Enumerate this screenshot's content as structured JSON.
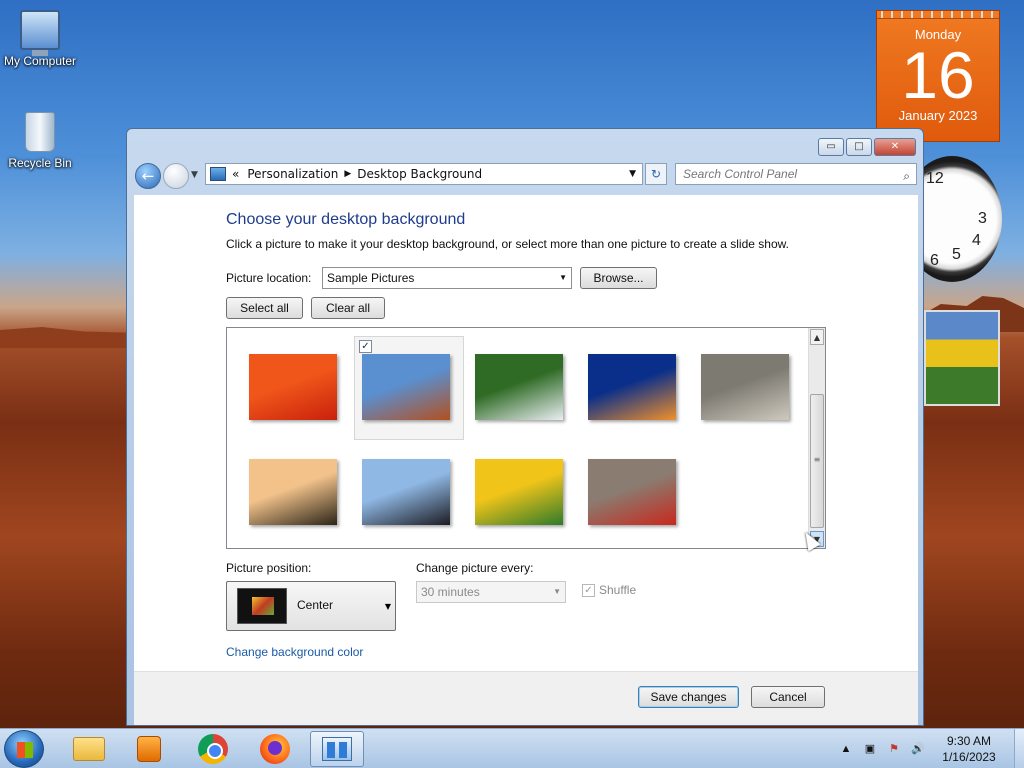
{
  "desktop": {
    "icons": [
      {
        "label": "My Computer"
      },
      {
        "label": "Recycle Bin"
      }
    ],
    "calendar": {
      "weekday": "Monday",
      "day": "16",
      "month_year": "January 2023"
    },
    "clock": {
      "numerals": [
        "12",
        "3",
        "4",
        "5",
        "6"
      ]
    }
  },
  "window": {
    "caption_buttons": {
      "minimize": "▭",
      "maximize": "□",
      "close": "✕"
    },
    "nav": {
      "back_glyph": "←",
      "address": {
        "prefix": "«",
        "crumbs": [
          "Personalization",
          "Desktop Background"
        ],
        "separator": "▶",
        "dropdown": "▼"
      },
      "refresh_glyph": "↻",
      "search": {
        "placeholder": "Search Control Panel"
      }
    },
    "content": {
      "title": "Choose your desktop background",
      "description": "Click a picture to make it your desktop background, or select more than one picture to create a slide show.",
      "picture_location_label": "Picture location:",
      "picture_location_value": "Sample Pictures",
      "browse_button": "Browse...",
      "select_all_button": "Select all",
      "clear_all_button": "Clear all",
      "thumbnails": [
        {
          "name": "chrysanthemum",
          "selected": false,
          "colors": [
            "#f0561a",
            "#c9210c"
          ]
        },
        {
          "name": "desert",
          "selected": true,
          "colors": [
            "#5a8fd0",
            "#b3501f"
          ]
        },
        {
          "name": "hydrangeas",
          "selected": false,
          "colors": [
            "#2f6b24",
            "#e9eef3"
          ]
        },
        {
          "name": "jellyfish",
          "selected": false,
          "colors": [
            "#0a2f8a",
            "#f0902a"
          ]
        },
        {
          "name": "koala",
          "selected": false,
          "colors": [
            "#7d7a72",
            "#cfc9bd"
          ]
        },
        {
          "name": "lighthouse",
          "selected": false,
          "colors": [
            "#f2c28a",
            "#2b2418"
          ]
        },
        {
          "name": "penguins",
          "selected": false,
          "colors": [
            "#8fb8e4",
            "#1c1c22"
          ]
        },
        {
          "name": "tulips",
          "selected": false,
          "colors": [
            "#f0c419",
            "#2f7a2a"
          ]
        },
        {
          "name": "santa",
          "selected": false,
          "colors": [
            "#8a7c70",
            "#c8281e"
          ]
        }
      ],
      "checkmark": "✓",
      "position_label": "Picture position:",
      "position_value": "Center",
      "interval_label": "Change picture every:",
      "interval_value": "30 minutes",
      "shuffle_label": "Shuffle",
      "shuffle_checked": true,
      "background_color_link": "Change background color"
    },
    "footer": {
      "save_button": "Save changes",
      "cancel_button": "Cancel"
    }
  },
  "taskbar": {
    "apps": [
      "explorer",
      "media-player",
      "chrome",
      "firefox",
      "control-panel"
    ],
    "active_app": "control-panel",
    "tray": {
      "time": "9:30 AM",
      "date": "1/16/2023",
      "volume_glyph": "🔊",
      "flag_glyph": "⚑",
      "network_glyph": "▣",
      "arrow_glyph": "▲"
    }
  }
}
